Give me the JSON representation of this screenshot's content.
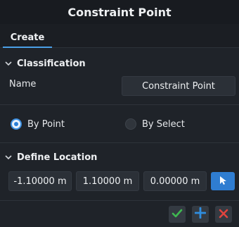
{
  "window": {
    "title": "Constraint Point"
  },
  "tabs": [
    {
      "label": "Create"
    }
  ],
  "classification": {
    "section_title": "Classification",
    "name_label": "Name",
    "name_value": "Constraint Point"
  },
  "mode": {
    "options": [
      {
        "label": "By Point",
        "selected": true
      },
      {
        "label": "By Select",
        "selected": false
      }
    ]
  },
  "define_location": {
    "section_title": "Define Location",
    "x": "-1.10000 m",
    "y": "1.10000 m",
    "z": "0.00000 m"
  },
  "icons": {
    "collapse": "chevron-down-icon",
    "pick": "cursor-arrow-icon",
    "confirm": "check-icon",
    "add": "plus-icon",
    "cancel": "close-icon"
  },
  "colors": {
    "accent": "#2f7dd1",
    "confirm": "#3fb950",
    "add": "#2f8ee0",
    "cancel": "#e0443e"
  }
}
